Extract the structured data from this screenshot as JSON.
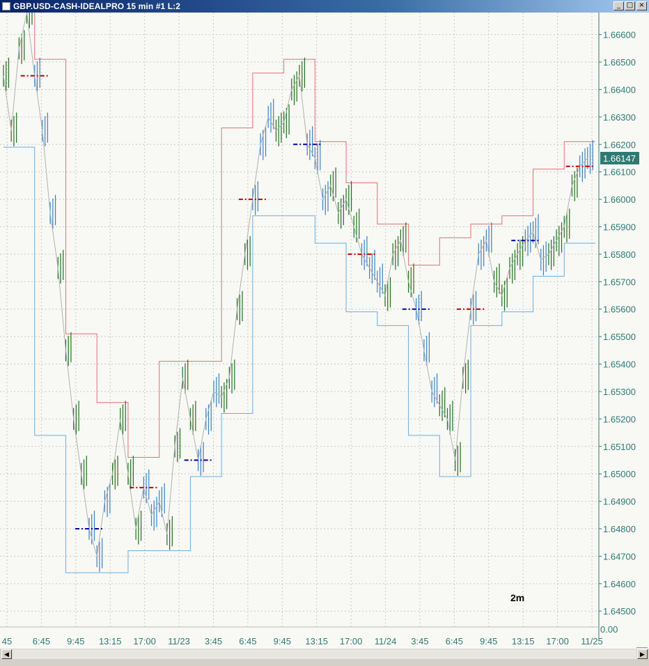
{
  "window": {
    "title": "GBP.USD-CASH-IDEALPRO  15 min   #1  L:2",
    "controls": {
      "minimize": "_",
      "maximize": "□",
      "close": "×"
    }
  },
  "colors": {
    "background": "#f8f8f5",
    "grid": "#c8c8c8",
    "axis_text": "#2e7a72",
    "candle_green": "#1e6e1e",
    "candle_blue": "#3a7fc0",
    "channel_red": "#e07070",
    "channel_blue": "#6aaee0",
    "level_blue": "#0000a0",
    "level_red": "#c00000",
    "current_price_bg": "#2e7a72"
  },
  "chart_data": {
    "type": "candlestick",
    "symbol": "GBP.USD-CASH-IDEALPRO",
    "timeframe": "15 min",
    "y_ticks": [
      "1.66600",
      "1.66500",
      "1.66400",
      "1.66300",
      "1.66200",
      "1.66100",
      "1.66000",
      "1.65900",
      "1.65800",
      "1.65700",
      "1.65600",
      "1.65500",
      "1.65400",
      "1.65300",
      "1.65200",
      "1.65100",
      "1.65000",
      "1.64900",
      "1.64800",
      "1.64700",
      "1.64600",
      "1.64500"
    ],
    "ylim": [
      1.6446,
      1.6666
    ],
    "current_price": "1.66147",
    "indicator_scale_label": "0.00",
    "x_ticks": [
      "45",
      "6:45",
      "9:45",
      "13:15",
      "17:00",
      "11/23",
      "3:45",
      "6:45",
      "9:45",
      "13:15",
      "17:00",
      "11/24",
      "3:45",
      "6:45",
      "9:45",
      "13:15",
      "17:00",
      "11/25"
    ],
    "annotation": "2m",
    "price_path": [
      1.6645,
      1.6625,
      1.6655,
      1.6668,
      1.6645,
      1.6625,
      1.6595,
      1.6575,
      1.6545,
      1.652,
      1.65,
      1.648,
      1.647,
      1.649,
      1.65,
      1.652,
      1.65,
      1.648,
      1.6495,
      1.6485,
      1.649,
      1.6478,
      1.651,
      1.6535,
      1.652,
      1.6505,
      1.652,
      1.653,
      1.6528,
      1.6535,
      1.656,
      1.658,
      1.66,
      1.662,
      1.663,
      1.6625,
      1.6628,
      1.664,
      1.6645,
      1.662,
      1.6615,
      1.66,
      1.6605,
      1.6595,
      1.66,
      1.659,
      1.658,
      1.6575,
      1.657,
      1.6565,
      1.658,
      1.6585,
      1.657,
      1.656,
      1.6545,
      1.653,
      1.6525,
      1.652,
      1.6505,
      1.6535,
      1.656,
      1.658,
      1.6585,
      1.657,
      1.6565,
      1.6575,
      1.658,
      1.6585,
      1.6588,
      1.6578,
      1.658,
      1.6585,
      1.659,
      1.6605,
      1.6612,
      1.6615
    ]
  },
  "chart": {
    "annotation": "2m",
    "current_price_label": "1.66147",
    "badge": "2"
  }
}
